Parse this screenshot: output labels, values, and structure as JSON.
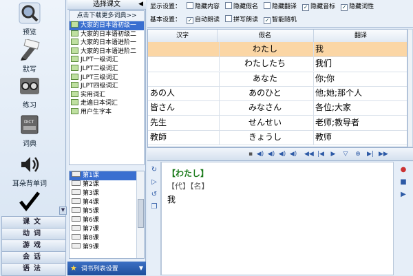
{
  "nav": {
    "tools": [
      {
        "label": "预览",
        "icon": "magnifier-icon"
      },
      {
        "label": "默写",
        "icon": "pen-icon"
      },
      {
        "label": "练习",
        "icon": "tape-icon"
      },
      {
        "label": "词典",
        "icon": "dictionary-icon"
      },
      {
        "label": "耳朵背单词",
        "icon": "speaker-icon"
      },
      {
        "label": "",
        "icon": "checkmark-icon"
      }
    ],
    "categories": [
      "课文",
      "动词",
      "游戏",
      "会话",
      "语法"
    ]
  },
  "lesson_panel": {
    "title": "选择课文",
    "download_link": "点击下载更多词典>>",
    "books": [
      "大家的日本语初级一",
      "大家的日本语初级二",
      "大家的日本语进阶一",
      "大家的日本语进阶二",
      "JLPT一级词汇",
      "JLPT二级词汇",
      "JLPT三级词汇",
      "JLPT四级词汇",
      "实用词汇",
      "走遍日本词汇",
      "用户生字本"
    ],
    "selected_book": 0,
    "lessons": [
      "第1课",
      "第2课",
      "第3课",
      "第4课",
      "第5课",
      "第6课",
      "第7课",
      "第8课",
      "第9课"
    ],
    "selected_lesson": 0,
    "settings_label": "词书列表设置"
  },
  "options": {
    "display_label": "显示设置：",
    "display_options": [
      {
        "label": "隐藏内容",
        "checked": false
      },
      {
        "label": "隐藏假名",
        "checked": false
      },
      {
        "label": "隐藏翻译",
        "checked": false
      },
      {
        "label": "隐藏音标",
        "checked": true
      },
      {
        "label": "隐藏词性",
        "checked": true
      }
    ],
    "basic_label": "基本设置：",
    "basic_options": [
      {
        "label": "自动朗读",
        "checked": true
      },
      {
        "label": "拼写朗读",
        "checked": false
      },
      {
        "label": "智能随机",
        "checked": true
      }
    ]
  },
  "table": {
    "headers": [
      "汉字",
      "假名",
      "翻译"
    ],
    "rows": [
      {
        "kanji": "",
        "kana": "わたし",
        "meaning": "我",
        "selected": true
      },
      {
        "kanji": "",
        "kana": "わたしたち",
        "meaning": "我们",
        "selected": false
      },
      {
        "kanji": "",
        "kana": "あなた",
        "meaning": "你;你",
        "selected": false
      },
      {
        "kanji": "あの人",
        "kana": "あのひと",
        "meaning": "他;她;那个人",
        "selected": false
      },
      {
        "kanji": "皆さん",
        "kana": "みなさん",
        "meaning": "各位;大家",
        "selected": false
      },
      {
        "kanji": "先生",
        "kana": "せんせい",
        "meaning": "老师;教导者",
        "selected": false
      },
      {
        "kanji": "教師",
        "kana": "きょうし",
        "meaning": "教师",
        "selected": false
      }
    ]
  },
  "detail": {
    "word": "【わたし】",
    "grammar": "【代】【名】",
    "meaning": "我"
  },
  "colors": {
    "selected_row": "#fbd6a5",
    "list_selection": "#3a6fd0",
    "word_green": "#1a7a1a"
  }
}
